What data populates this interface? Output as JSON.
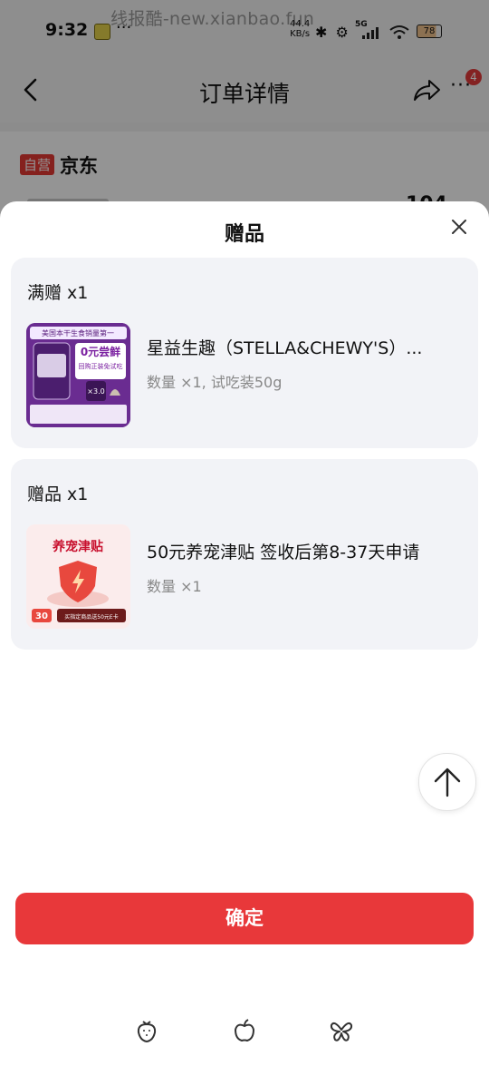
{
  "status_bar": {
    "time": "9:32",
    "dots": "···",
    "speed_top": "44.4",
    "speed_bottom": "KB/s",
    "icons_text": "✱ ⚙",
    "network": "5G",
    "battery": "78"
  },
  "watermark": "线报酷-new.xianbao.fun",
  "nav": {
    "title": "订单详情",
    "more_icon": "···",
    "badge": "4"
  },
  "shop": {
    "self_operated_tag": "自营",
    "name": "京东",
    "price_partial": "104"
  },
  "sheet": {
    "title": "赠品",
    "groups": [
      {
        "heading": "满赠 x1",
        "item_name": "星益生趣（STELLA&CHEWY'S）...",
        "meta": "数量 ×1, 试吃装50g",
        "thumb": {
          "banner": "美国本干生食销量第一",
          "headline": "0元尝鲜",
          "sub": "回购正装免试吃",
          "badge": "×3.0"
        }
      },
      {
        "heading": "赠品 x1",
        "item_name": "50元养宠津贴 签收后第8-37天申请",
        "meta": "数量 ×1",
        "thumb": {
          "headline": "养宠津贴",
          "amount": "30",
          "caption": "买指定商品送50元E卡"
        }
      }
    ],
    "confirm_label": "确定"
  },
  "colors": {
    "accent": "#e8383a",
    "card_bg": "#f2f3f7",
    "thumb_purple": "#6a2c91"
  }
}
